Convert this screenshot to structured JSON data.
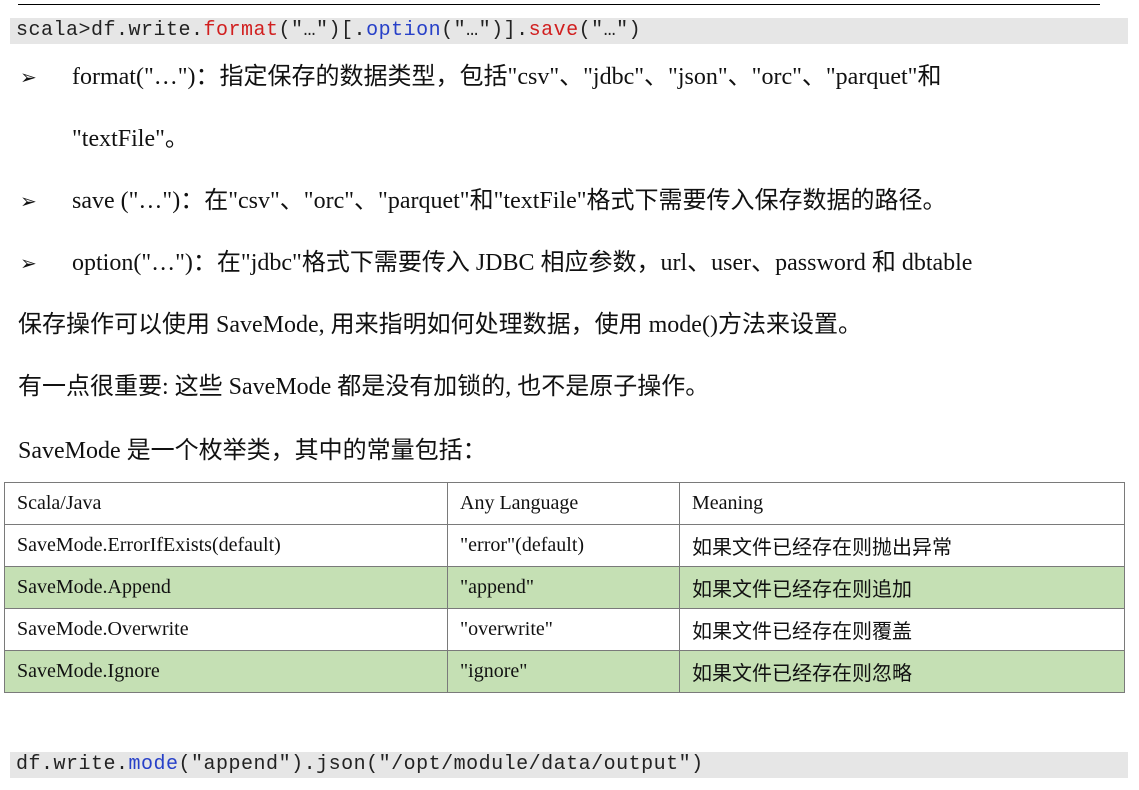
{
  "code_top": {
    "prefix": "scala>df.write.",
    "format_kw": "format",
    "mid1": "(\"…\")[.",
    "option_kw": "option",
    "mid2": "(\"…\")].",
    "save_kw": "save",
    "suffix": "(\"…\")"
  },
  "bullets": [
    {
      "line1": "format(\"…\")：指定保存的数据类型，包括\"csv\"、\"jdbc\"、\"json\"、\"orc\"、\"parquet\"和",
      "line2": "\"textFile\"。"
    },
    {
      "line1": "save (\"…\")：在\"csv\"、\"orc\"、\"parquet\"和\"textFile\"格式下需要传入保存数据的路径。"
    },
    {
      "line1": "option(\"…\")：在\"jdbc\"格式下需要传入 JDBC 相应参数，url、user、password 和 dbtable"
    }
  ],
  "paragraphs": {
    "p1": "保存操作可以使用  SaveMode, 用来指明如何处理数据，使用 mode()方法来设置。",
    "p2": "有一点很重要: 这些  SaveMode  都是没有加锁的, 也不是原子操作。",
    "p3": "SaveMode 是一个枚举类，其中的常量包括："
  },
  "table": {
    "headers": [
      "Scala/Java",
      "Any Language",
      "Meaning"
    ],
    "rows": [
      [
        "SaveMode.ErrorIfExists(default)",
        "\"error\"(default)",
        "如果文件已经存在则抛出异常"
      ],
      [
        "SaveMode.Append",
        "\"append\"",
        "如果文件已经存在则追加"
      ],
      [
        "SaveMode.Overwrite",
        "\"overwrite\"",
        "如果文件已经存在则覆盖"
      ],
      [
        "SaveMode.Ignore",
        "\"ignore\"",
        "如果文件已经存在则忽略"
      ]
    ],
    "shaded_color": "#c5e0b4"
  },
  "code_bottom": {
    "prefix": "df.write.",
    "mode_kw": "mode",
    "suffix": "(\"append\").json(\"/opt/module/data/output\")"
  },
  "colors": {
    "keyword_red": "#d11f1f",
    "keyword_blue": "#2740c8",
    "code_bg": "#e6e6e6"
  },
  "icons": {
    "bullet": "arrow-bullet-icon"
  }
}
